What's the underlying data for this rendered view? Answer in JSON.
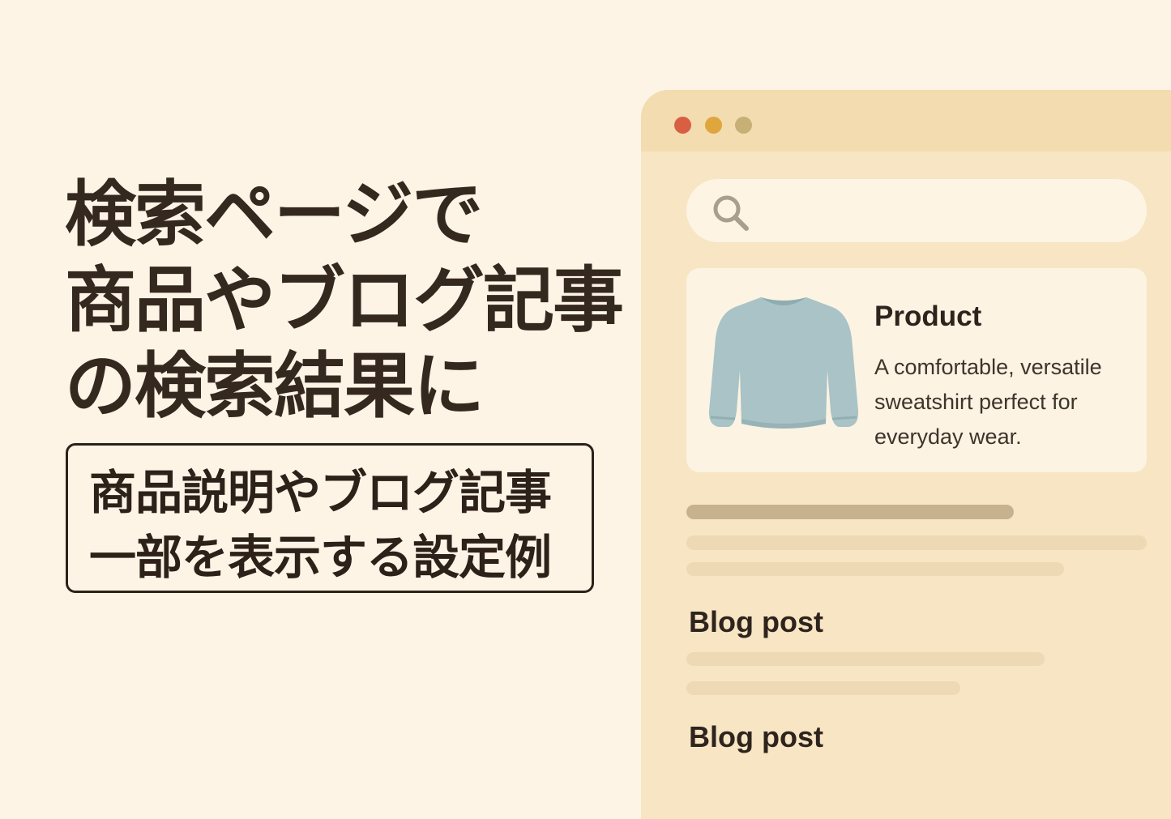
{
  "headline": {
    "lines": [
      "検索ページで",
      "商品やブログ記事",
      "の検索結果に"
    ]
  },
  "subtitle": {
    "lines": [
      "商品説明やブログ記事",
      "一部を表示する設定例"
    ]
  },
  "browser": {
    "window_controls": [
      "red",
      "yellow",
      "olive"
    ],
    "search": {
      "icon": "search-icon",
      "value": ""
    },
    "product_card": {
      "image": "sweatshirt-icon",
      "title": "Product",
      "description": "A comfortable, versatile sweatshirt perfect for everyday wear."
    },
    "blog_posts": [
      {
        "title": "Blog post"
      },
      {
        "title": "Blog post"
      }
    ]
  },
  "colors": {
    "background": "#fdf4e5",
    "browser": "#f7e5c4",
    "titlebar": "#f3dcb0",
    "text": "#2e241d",
    "close": "#d95f43",
    "minimize": "#e0a63e",
    "maximize": "#c7b075",
    "sweatshirt": "#a9c3c6"
  }
}
